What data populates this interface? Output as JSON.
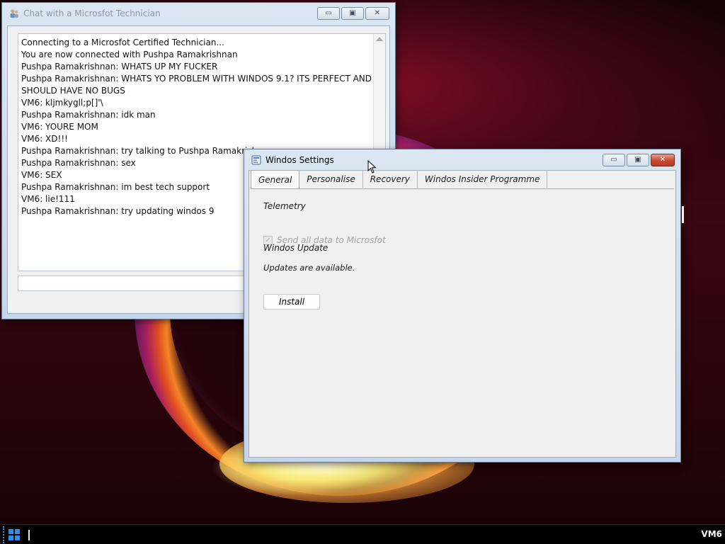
{
  "chat_window": {
    "title": "Chat with a Microsfot Technician",
    "lines": [
      "Connecting to a Microsfot Certified Technician...",
      "You are now connected with Pushpa Ramakrishnan",
      "Pushpa Ramakrishnan: WHATS UP MY FUCKER",
      "Pushpa Ramakrishnan: WHATS YO PROBLEM WITH WINDOS 9.1? ITS PERFECT AND SHOULD HAVE NO BUGS",
      "VM6: kljmkygll;p[]'\\",
      "Pushpa Ramakrishnan: idk man",
      "VM6: YOURE MOM",
      "VM6: XD!!!",
      "Pushpa Ramakrishnan: try talking to Pushpa Ramakrishnan",
      "Pushpa Ramakrishnan: sex",
      "VM6: SEX",
      "Pushpa Ramakrishnan: im best tech support",
      "VM6: lie!111",
      "Pushpa Ramakrishnan: try updating windos 9"
    ],
    "input_value": ""
  },
  "settings_window": {
    "title": "Windos Settings",
    "tabs": [
      {
        "label": "General",
        "selected": true
      },
      {
        "label": "Personalise",
        "selected": false
      },
      {
        "label": "Recovery",
        "selected": false
      },
      {
        "label": "Windos Insider Programme",
        "selected": false
      }
    ],
    "general": {
      "telemetry_heading": "Telemetry",
      "telemetry_checkbox_label": "Send all data to Microsfot",
      "telemetry_checked": true,
      "telemetry_enabled": false,
      "update_heading": "Windos Update",
      "update_status": "Updates are available.",
      "install_label": "Install"
    }
  },
  "caption_buttons": {
    "minimize": "▭",
    "maximize": "▣",
    "close": "✕"
  },
  "taskbar": {
    "clock_text": "VM6"
  },
  "icons": {
    "chat_icon": "users-icon",
    "settings_icon": "settings-app-icon",
    "start_icon": "windows-logo-icon"
  },
  "colors": {
    "accent": "#2f8fe8",
    "close_red": "#c74a35"
  }
}
